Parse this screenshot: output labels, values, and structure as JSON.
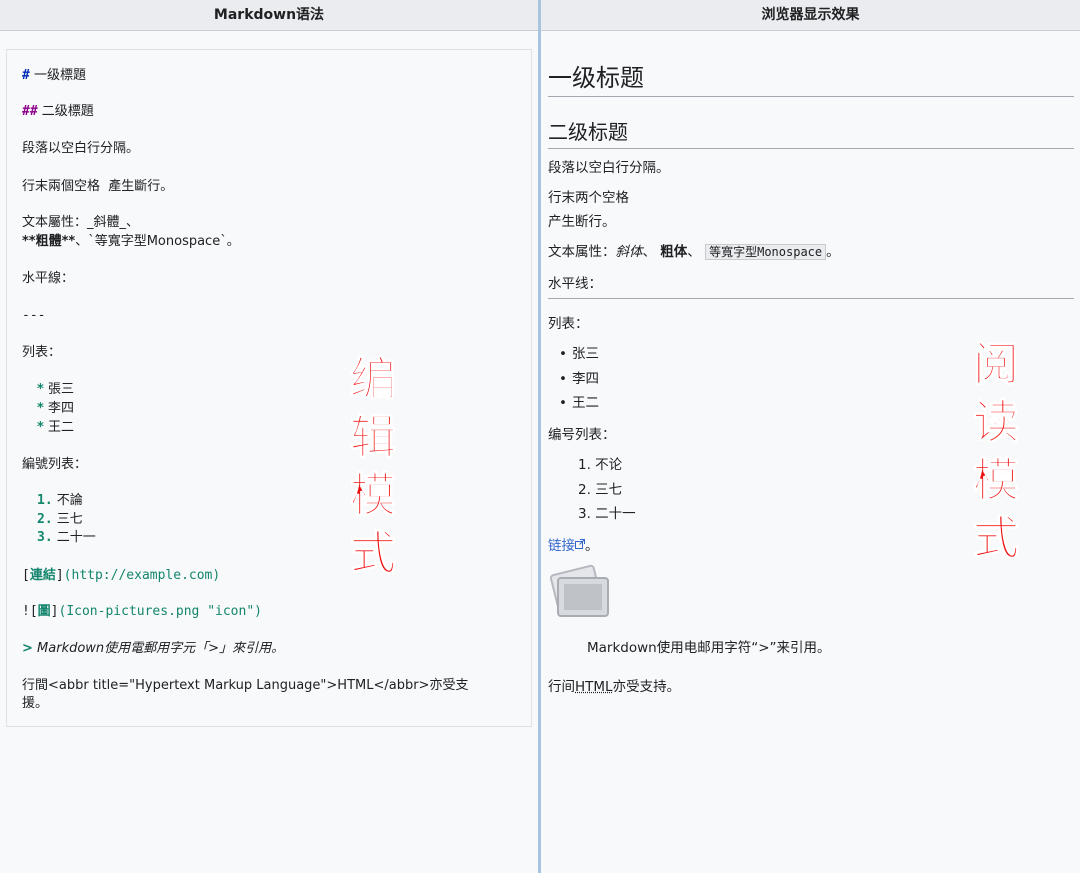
{
  "left": {
    "header": "Markdown语法",
    "lines": {
      "h1_mark": "#",
      "h1_text": " 一级標題",
      "h2_mark": "##",
      "h2_text": " 二级標題",
      "para": "段落以空白行分隔。",
      "linebreak": "行末兩個空格  產生斷行。",
      "attr1": "文本屬性：_斜體_、",
      "attr2_bold": "**粗體**",
      "attr2_rest": "、`等寬字型Monospace`。",
      "hr_label": "水平線：",
      "hr_mark": "---",
      "list_label": "列表：",
      "list_items": [
        "張三",
        "李四",
        "王二"
      ],
      "list_mark": "*",
      "olist_label": "編號列表：",
      "olist_items": [
        "不論",
        "三七",
        "二十一"
      ],
      "olist_nums": [
        "1.",
        "2.",
        "3."
      ],
      "link_open": "[",
      "link_text": "連結",
      "link_close": "]",
      "link_url": "(http://example.com)",
      "img_prefix": "![",
      "img_text": "圖",
      "img_mid": "]",
      "img_url": "(Icon-pictures.png \"icon\")",
      "quote_mark": ">",
      "quote_text": " Markdown使用電郵用字元「>」來引用。",
      "html_line1": "行間<abbr title=\"Hypertext Markup Language\">HTML</abbr>亦受支",
      "html_line2": "援。"
    },
    "overlay_label": [
      "编",
      "辑",
      "模",
      "式"
    ]
  },
  "right": {
    "header": "浏览器显示效果",
    "h1": "一级标题",
    "h2": "二级标题",
    "para": "段落以空白行分隔。",
    "br1": "行末两个空格",
    "br2": "产生断行。",
    "attr_prefix": "文本属性：",
    "attr_italic": "斜体",
    "attr_sep1": "、",
    "attr_bold": "粗体",
    "attr_sep2": "、",
    "attr_code": "等寬字型Monospace",
    "attr_end": "。",
    "hr_label": "水平线：",
    "list_label": "列表：",
    "list_items": [
      "张三",
      "李四",
      "王二"
    ],
    "olist_label": "编号列表：",
    "olist_items": [
      "1. 不论",
      "2. 三七",
      "3. 二十一"
    ],
    "link_text": "链接",
    "link_after": "。",
    "quote": "Markdown使用电邮用字符“>”来引用。",
    "html_prefix": "行间",
    "html_abbr": "HTML",
    "html_suffix": "亦受支持。",
    "overlay_label": [
      "阅",
      "读",
      "模",
      "式"
    ]
  },
  "colors": {
    "overlay": "#ee1111",
    "link": "#3366cc",
    "divider": "#a7c4e0"
  }
}
